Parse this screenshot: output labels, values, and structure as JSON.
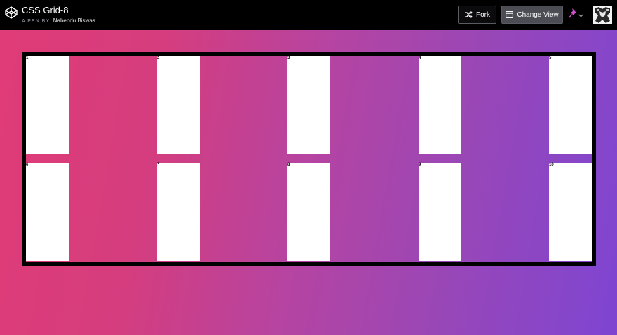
{
  "header": {
    "title": "CSS Grid-8",
    "byline_prefix": "A PEN BY",
    "author": "Nabendu Biswas",
    "fork_label": "Fork",
    "change_view_label": "Change View"
  },
  "colors": {
    "gradient_start": "#e03c77",
    "gradient_end": "#7e45d2",
    "topbar": "#000000"
  },
  "icons": [
    "codepen-logo-icon",
    "fork-icon",
    "layout-icon",
    "pin-icon",
    "chevron-down-icon",
    "avatar"
  ],
  "grid": {
    "cells": [
      "1",
      "2",
      "3",
      "4",
      "5",
      "6",
      "7",
      "8",
      "9",
      "10"
    ]
  }
}
